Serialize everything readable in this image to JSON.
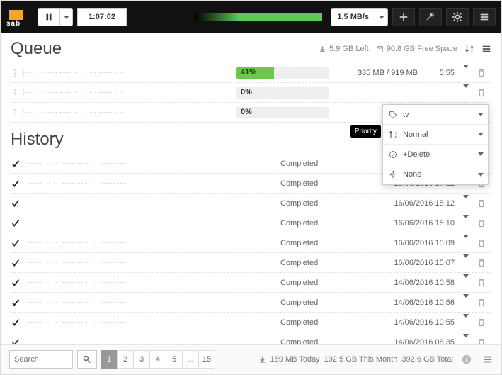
{
  "topbar": {
    "logo_text": "sab",
    "time_remaining": "1:07:02",
    "speed": "1.5 MB/s"
  },
  "queue": {
    "title": "Queue",
    "space_left": "5.9 GB Left",
    "free_space": "90.8 GB Free Space",
    "items": [
      {
        "progress_pct": 41,
        "progress_label": "41%",
        "size": "385 MB / 919 MB",
        "eta": "5:55"
      },
      {
        "progress_pct": 0,
        "progress_label": "0%",
        "size": "",
        "eta": ""
      },
      {
        "progress_pct": 0,
        "progress_label": "0%",
        "size": "",
        "eta": ""
      }
    ]
  },
  "popup": {
    "tooltip": "Priority",
    "category": "tv",
    "priority": "Normal",
    "pp": "+Delete",
    "script": "None"
  },
  "history": {
    "title": "History",
    "items": [
      {
        "status": "Completed",
        "date": ""
      },
      {
        "status": "Completed",
        "date": "18/06/2016 17:12"
      },
      {
        "status": "Completed",
        "date": "16/06/2016 15:12"
      },
      {
        "status": "Completed",
        "date": "16/06/2016 15:10"
      },
      {
        "status": "Completed",
        "date": "16/06/2016 15:09"
      },
      {
        "status": "Completed",
        "date": "16/06/2016 15:07"
      },
      {
        "status": "Completed",
        "date": "14/06/2016 10:58"
      },
      {
        "status": "Completed",
        "date": "14/06/2016 10:56"
      },
      {
        "status": "Completed",
        "date": "14/06/2016 10:55"
      },
      {
        "status": "Completed",
        "date": "14/06/2016 08:35"
      }
    ]
  },
  "footer": {
    "search_placeholder": "Search",
    "pages": [
      "1",
      "2",
      "3",
      "4",
      "5",
      "...",
      "15"
    ],
    "active_page": "1",
    "stats_today": "189 MB Today",
    "stats_month": "192.5 GB This Month",
    "stats_total": "392.6 GB Total"
  }
}
